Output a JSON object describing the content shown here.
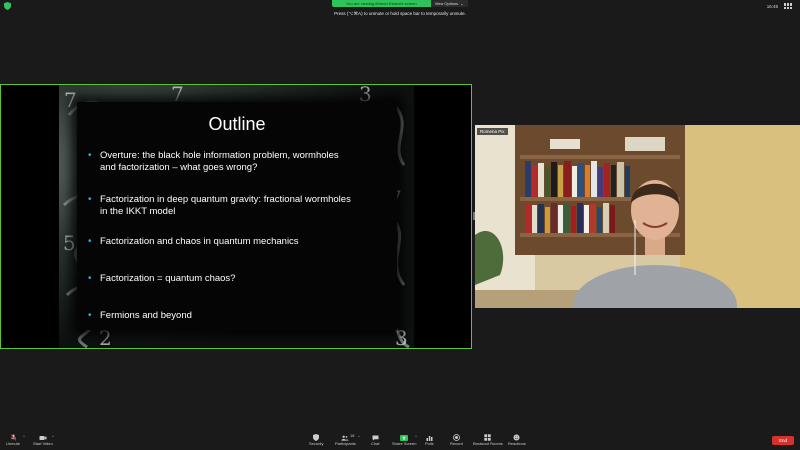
{
  "top_bar": {
    "sharing_text": "You are viewing Ahmed Eslami's screen",
    "view_options": "View Options",
    "unmute_hint_key": "Press  (⌥⌘A) to unmute or hold space bar to temporarily unmute.",
    "time": "16:45"
  },
  "slide": {
    "title": "Outline",
    "bullets": [
      {
        "line1": "Overture: the black hole information problem, wormholes",
        "line2": "and factorization – what goes wrong?"
      },
      {
        "line1": "Factorization in deep quantum gravity: fractional wormholes",
        "line2": "in the IKKT model"
      },
      {
        "line1": "Factorization and chaos in quantum mechanics",
        "line2": ""
      },
      {
        "line1": "Factorization = quantum chaos?",
        "line2": ""
      },
      {
        "line1": "Fermions and beyond",
        "line2": ""
      }
    ]
  },
  "participant": {
    "name": "Romena Pix"
  },
  "toolbar": {
    "unmute": "Unmute",
    "start_video": "Start Video",
    "security": "Security",
    "participants": "Participants",
    "participants_count": "18",
    "chat": "Chat",
    "share_screen": "Share Screen",
    "polls": "Polls",
    "record": "Record",
    "breakout_rooms": "Breakout Rooms",
    "reactions": "Reactions",
    "end": "End"
  },
  "colors": {
    "accent_green": "#5cc33a",
    "end_red": "#d6322d",
    "bullet_blue": "#3aa6d9"
  }
}
